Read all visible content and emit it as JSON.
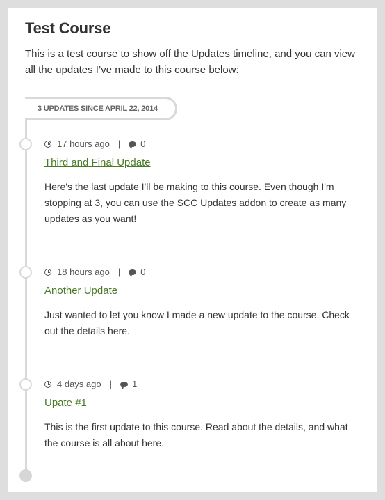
{
  "course": {
    "title": "Test Course",
    "intro": "This is a test course to show off the Updates timeline, and you can view all the updates I’ve made to this course below:"
  },
  "timeline": {
    "since_label": "3 UPDATES SINCE APRIL 22, 2014",
    "line_color": "#d9d9d9",
    "link_color": "#4a7a26"
  },
  "updates": [
    {
      "time": "17 hours ago",
      "comments": "0",
      "title": "Third and Final Update",
      "body": "Here's the last update I'll be making to this course. Even though I'm stopping at 3, you can use the SCC Updates addon to create as many updates as you want!"
    },
    {
      "time": "18 hours ago",
      "comments": "0",
      "title": "Another Update",
      "body": "Just wanted to let you know I made a new update to the course. Check out the details here."
    },
    {
      "time": "4 days ago",
      "comments": "1",
      "title": "Upate #1",
      "body": "This is the first update to this course. Read about the details, and what the course is all about here."
    }
  ],
  "icons": {
    "time": "clock-icon",
    "comments": "comment-icon"
  },
  "separator": "|"
}
